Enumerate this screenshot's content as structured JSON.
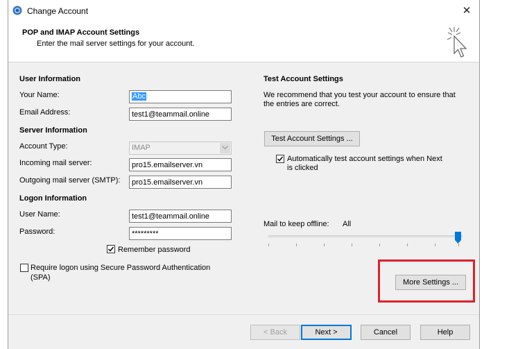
{
  "window": {
    "title": "Change Account",
    "close_glyph": "✕"
  },
  "header": {
    "title": "POP and IMAP Account Settings",
    "subtitle": "Enter the mail server settings for your account."
  },
  "user_info": {
    "section": "User Information",
    "name_label": "Your Name:",
    "name_value": "Abc",
    "email_label": "Email Address:",
    "email_value": "test1@teammail.online"
  },
  "server_info": {
    "section": "Server Information",
    "account_type_label": "Account Type:",
    "account_type_value": "IMAP",
    "incoming_label": "Incoming mail server:",
    "incoming_value": "pro15.emailserver.vn",
    "outgoing_label": "Outgoing mail server (SMTP):",
    "outgoing_value": "pro15.emailserver.vn"
  },
  "logon_info": {
    "section": "Logon Information",
    "username_label": "User Name:",
    "username_value": "test1@teammail.online",
    "password_label": "Password:",
    "password_value": "*********",
    "remember_label": "Remember password",
    "remember_checked": true,
    "spa_label_line1": "Require logon using Secure Password Authentication",
    "spa_label_line2": "(SPA)",
    "spa_checked": false
  },
  "test_settings": {
    "section": "Test Account Settings",
    "description_line1": "We recommend that you test your account to ensure that",
    "description_line2": "the entries are correct.",
    "test_button": "Test Account Settings ...",
    "auto_test_line1": "Automatically test account settings when Next",
    "auto_test_line2": "is clicked",
    "auto_test_checked": true
  },
  "offline": {
    "label": "Mail to keep offline:",
    "value": "All",
    "level_fraction": 1.0
  },
  "more_settings_button": "More Settings ...",
  "footer": {
    "back": "< Back",
    "next": "Next >",
    "cancel": "Cancel",
    "help": "Help"
  },
  "colors": {
    "highlight_border": "#e0202a",
    "accent": "#0078d7",
    "selection": "#3399ff"
  },
  "icons": {
    "app": "outlook-account-icon",
    "wizard": "cursor-sparkle-icon",
    "close": "close-icon"
  }
}
